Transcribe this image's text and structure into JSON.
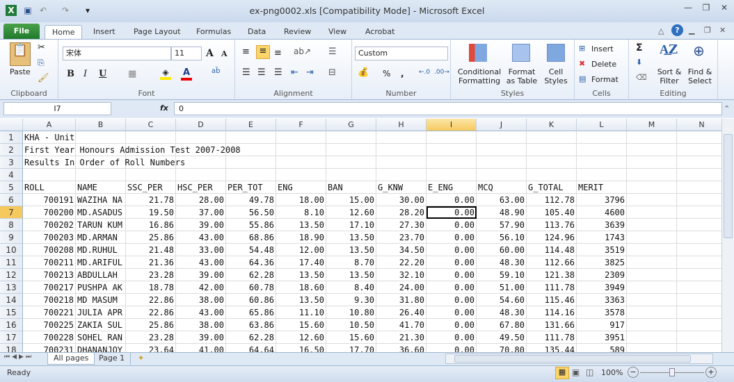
{
  "window": {
    "title": "ex-png0002.xls  [Compatibility Mode]  -  Microsoft Excel"
  },
  "tabs": {
    "file": "File",
    "items": [
      "Home",
      "Insert",
      "Page Layout",
      "Formulas",
      "Data",
      "Review",
      "View",
      "Acrobat"
    ],
    "active": "Home"
  },
  "ribbon": {
    "clipboard": {
      "label": "Clipboard",
      "paste": "Paste"
    },
    "font": {
      "label": "Font",
      "name": "宋体",
      "size": "11",
      "bold": "B",
      "italic": "I",
      "underline": "U"
    },
    "alignment": {
      "label": "Alignment"
    },
    "number": {
      "label": "Number",
      "format": "Custom",
      "percent": "%",
      "comma": ","
    },
    "styles": {
      "label": "Styles",
      "conditional": "Conditional Formatting",
      "format_table": "Format as Table",
      "cell_styles": "Cell Styles"
    },
    "cells": {
      "label": "Cells",
      "insert": "Insert",
      "delete": "Delete",
      "format": "Format"
    },
    "editing": {
      "label": "Editing",
      "sum": "Σ",
      "sort": "Sort & Filter",
      "find": "Find & Select"
    }
  },
  "formula_bar": {
    "name_box": "I7",
    "fx": "fx",
    "value": "0"
  },
  "sheet": {
    "columns": [
      "A",
      "B",
      "C",
      "D",
      "E",
      "F",
      "G",
      "H",
      "I",
      "J",
      "K",
      "L",
      "M",
      "N"
    ],
    "selected_column": "I",
    "selected_row": 7,
    "active_cell": "I7",
    "rows": [
      {
        "n": 1,
        "text": "KHA - Unit"
      },
      {
        "n": 2,
        "text": "First Year Honours Admission Test 2007-2008"
      },
      {
        "n": 3,
        "text": "Results In Order of Roll Numbers"
      },
      {
        "n": 4,
        "text": ""
      },
      {
        "n": 5,
        "cells": [
          "ROLL",
          "NAME",
          "SSC_PER",
          "HSC_PER",
          "PER_TOT",
          "ENG",
          "BAN",
          "G_KNW",
          "E_ENG",
          "MCQ",
          "G_TOTAL",
          "MERIT"
        ]
      },
      {
        "n": 6,
        "cells": [
          "700191",
          "WAZIHA NA",
          "21.78",
          "28.00",
          "49.78",
          "18.00",
          "15.00",
          "30.00",
          "0.00",
          "63.00",
          "112.78",
          "3796"
        ]
      },
      {
        "n": 7,
        "cells": [
          "700200",
          "MD.ASADUS",
          "19.50",
          "37.00",
          "56.50",
          "8.10",
          "12.60",
          "28.20",
          "0.00",
          "48.90",
          "105.40",
          "4600"
        ]
      },
      {
        "n": 8,
        "cells": [
          "700202",
          "TARUN KUM",
          "16.86",
          "39.00",
          "55.86",
          "13.50",
          "17.10",
          "27.30",
          "0.00",
          "57.90",
          "113.76",
          "3639"
        ]
      },
      {
        "n": 9,
        "cells": [
          "700203",
          "MD.ARMAN",
          "25.86",
          "43.00",
          "68.86",
          "18.90",
          "13.50",
          "23.70",
          "0.00",
          "56.10",
          "124.96",
          "1743"
        ]
      },
      {
        "n": 10,
        "cells": [
          "700208",
          "MD.RUHUL",
          "21.48",
          "33.00",
          "54.48",
          "12.00",
          "13.50",
          "34.50",
          "0.00",
          "60.00",
          "114.48",
          "3519"
        ]
      },
      {
        "n": 11,
        "cells": [
          "700211",
          "MD.ARIFUL",
          "21.36",
          "43.00",
          "64.36",
          "17.40",
          "8.70",
          "22.20",
          "0.00",
          "48.30",
          "112.66",
          "3825"
        ]
      },
      {
        "n": 12,
        "cells": [
          "700213",
          "ABDULLAH",
          "23.28",
          "39.00",
          "62.28",
          "13.50",
          "13.50",
          "32.10",
          "0.00",
          "59.10",
          "121.38",
          "2309"
        ]
      },
      {
        "n": 13,
        "cells": [
          "700217",
          "PUSHPA AK",
          "18.78",
          "42.00",
          "60.78",
          "18.60",
          "8.40",
          "24.00",
          "0.00",
          "51.00",
          "111.78",
          "3949"
        ]
      },
      {
        "n": 14,
        "cells": [
          "700218",
          "MD MASUM",
          "22.86",
          "38.00",
          "60.86",
          "13.50",
          "9.30",
          "31.80",
          "0.00",
          "54.60",
          "115.46",
          "3363"
        ]
      },
      {
        "n": 15,
        "cells": [
          "700221",
          "JULIA APR",
          "22.86",
          "43.00",
          "65.86",
          "11.10",
          "10.80",
          "26.40",
          "0.00",
          "48.30",
          "114.16",
          "3578"
        ]
      },
      {
        "n": 16,
        "cells": [
          "700225",
          "ZAKIA SUL",
          "25.86",
          "38.00",
          "63.86",
          "15.60",
          "10.50",
          "41.70",
          "0.00",
          "67.80",
          "131.66",
          "917"
        ]
      },
      {
        "n": 17,
        "cells": [
          "700228",
          "SOHEL RAN",
          "23.28",
          "39.00",
          "62.28",
          "12.60",
          "15.60",
          "21.30",
          "0.00",
          "49.50",
          "111.78",
          "3951"
        ]
      },
      {
        "n": 18,
        "cells": [
          "700231",
          "DHANANJOY",
          "23.64",
          "41.00",
          "64.64",
          "16.50",
          "17.70",
          "36.60",
          "0.00",
          "70.80",
          "135.44",
          "589"
        ]
      }
    ]
  },
  "sheet_tabs": [
    "All pages",
    "Page 1"
  ],
  "status": {
    "text": "Ready",
    "zoom": "100%",
    "zoom_minus": "−",
    "zoom_plus": "+"
  }
}
